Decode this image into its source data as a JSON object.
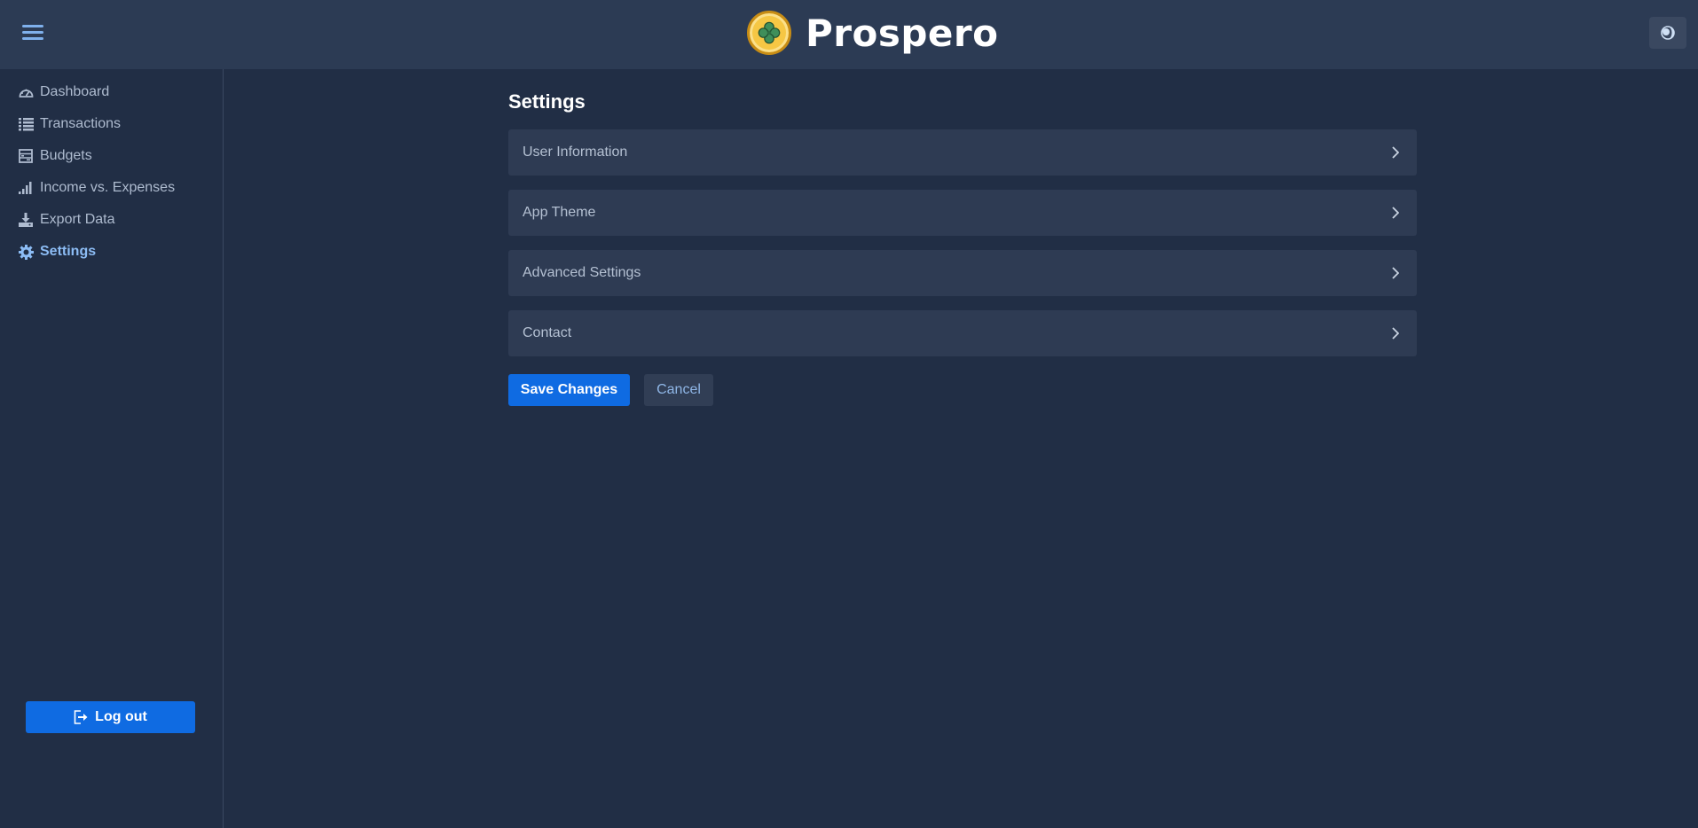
{
  "header": {
    "menu_icon": "hamburger-menu-icon",
    "brand_name": "Prospero",
    "logo_icon": "clover-icon",
    "theme_toggle_icon": "half-moon-icon"
  },
  "sidebar": {
    "items": [
      {
        "label": "Dashboard",
        "icon": "speedometer-icon",
        "active": false
      },
      {
        "label": "Transactions",
        "icon": "list-icon",
        "active": false
      },
      {
        "label": "Budgets",
        "icon": "ledger-icon",
        "active": false
      },
      {
        "label": "Income vs. Expenses",
        "icon": "bar-chart-icon",
        "active": false
      },
      {
        "label": "Export Data",
        "icon": "download-icon",
        "active": false
      },
      {
        "label": "Settings",
        "icon": "gear-icon",
        "active": true
      }
    ],
    "logout_label": "Log out"
  },
  "main": {
    "title": "Settings",
    "panels": [
      {
        "label": "User Information"
      },
      {
        "label": "App Theme"
      },
      {
        "label": "Advanced Settings"
      },
      {
        "label": "Contact"
      }
    ],
    "save_label": "Save Changes",
    "cancel_label": "Cancel"
  },
  "colors": {
    "background": "#212e45",
    "header": "#2c3b54",
    "panel": "#2e3b53",
    "accent": "#0f6be2",
    "active_nav": "#8cbcf4"
  }
}
